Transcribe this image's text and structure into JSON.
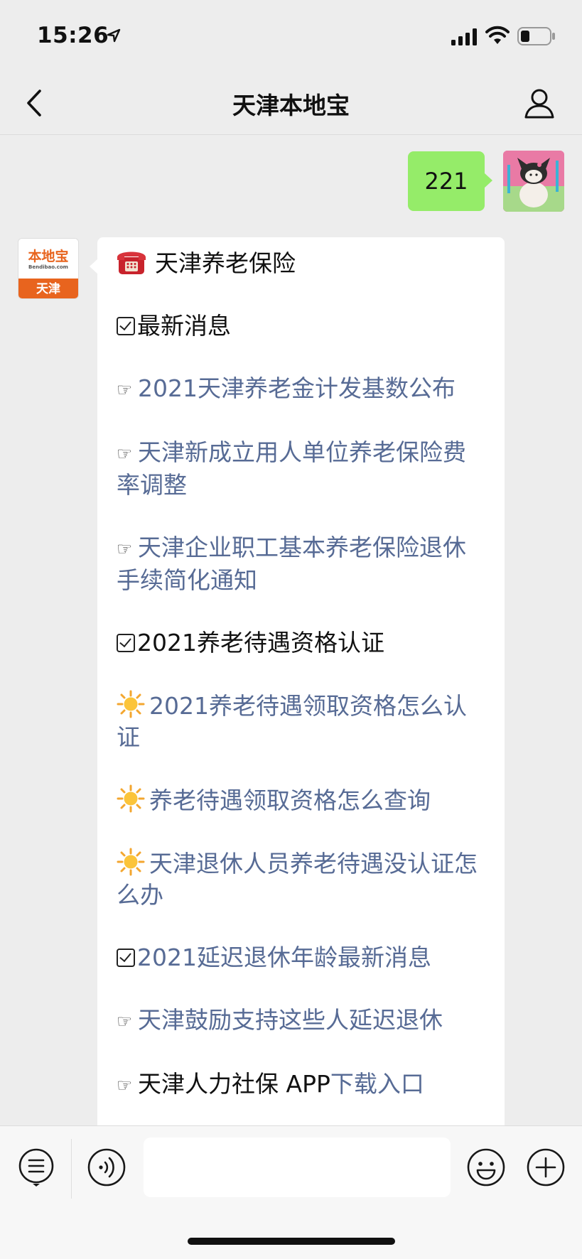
{
  "status_bar": {
    "time": "15:26",
    "icons": [
      "location-arrow-icon",
      "signal-icon",
      "wifi-icon",
      "battery-icon"
    ]
  },
  "nav": {
    "title": "天津本地宝",
    "back_icon": "chevron-left-icon",
    "profile_icon": "person-icon"
  },
  "messages": {
    "outgoing": {
      "text": "221",
      "bubble_color": "#95ec69"
    },
    "incoming": {
      "avatar": {
        "brand": "本地宝",
        "domain": "Bendibao.com",
        "city": "天津",
        "brand_color": "#e8641e"
      },
      "header": "天津养老保险",
      "lines": [
        {
          "kind": "section",
          "text": "最新消息"
        },
        {
          "kind": "link",
          "prefix": "hand",
          "text": "2021天津养老金计发基数公布"
        },
        {
          "kind": "link",
          "prefix": "hand",
          "text": "天津新成立用人单位养老保险费率调整"
        },
        {
          "kind": "link",
          "prefix": "hand",
          "text": "天津企业职工基本养老保险退休手续简化通知"
        },
        {
          "kind": "section",
          "text": "2021养老待遇资格认证"
        },
        {
          "kind": "link",
          "prefix": "sun",
          "text": "2021养老待遇领取资格怎么认证"
        },
        {
          "kind": "link",
          "prefix": "sun",
          "text": "养老待遇领取资格怎么查询"
        },
        {
          "kind": "link",
          "prefix": "sun",
          "text": "天津退休人员养老待遇没认证怎么办"
        },
        {
          "kind": "section-link",
          "text": "2021延迟退休年龄最新消息"
        },
        {
          "kind": "link",
          "prefix": "hand",
          "text": "天津鼓励支持这些人延迟退休"
        },
        {
          "kind": "mixed",
          "prefix": "hand",
          "text": "天津人力社保 APP",
          "link_text": "下载入口"
        }
      ],
      "link_color": "#576b95"
    }
  },
  "input_bar": {
    "placeholder": "",
    "icons": [
      "menu-list-icon",
      "voice-icon",
      "emoji-icon",
      "plus-icon"
    ]
  }
}
